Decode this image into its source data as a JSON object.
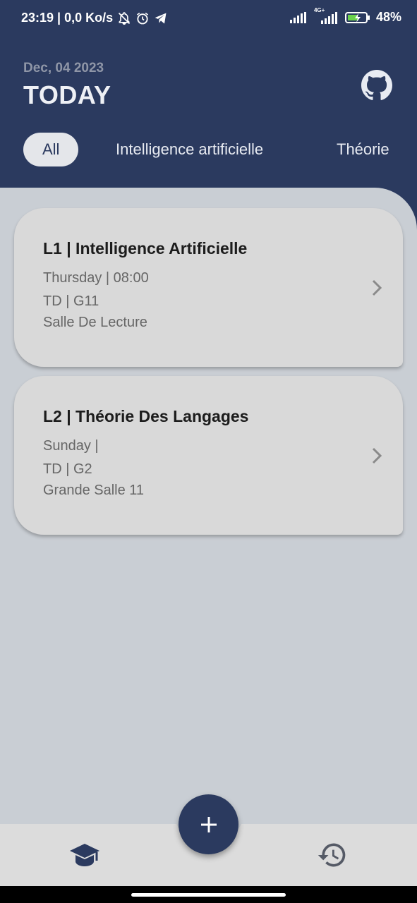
{
  "status_bar": {
    "time_info": "23:19 | 0,0 Ko/s",
    "network_label": "4G+",
    "battery": "48%"
  },
  "header": {
    "date": "Dec, 04 2023",
    "title": "TODAY"
  },
  "filters": [
    {
      "label": "All",
      "active": true
    },
    {
      "label": "Intelligence artificielle",
      "active": false
    },
    {
      "label": "Théorie",
      "active": false
    }
  ],
  "courses": [
    {
      "title": "L1 | Intelligence Artificielle",
      "day_time": "Thursday | 08:00",
      "type_group": "TD | G11",
      "room": "Salle De Lecture"
    },
    {
      "title": "L2 | Théorie Des Langages",
      "day_time": "Sunday |",
      "type_group": "TD | G2",
      "room": "Grande Salle 11"
    }
  ],
  "icons": {
    "github": "github-icon",
    "chevron": "chevron-right-icon",
    "add": "plus-icon",
    "nav_courses": "graduation-cap-icon",
    "nav_history": "history-icon"
  },
  "colors": {
    "primary": "#2b3a5f",
    "background": "#c9ced4",
    "card": "#d9d9d9",
    "bottom_bar": "#dcdcdc"
  }
}
